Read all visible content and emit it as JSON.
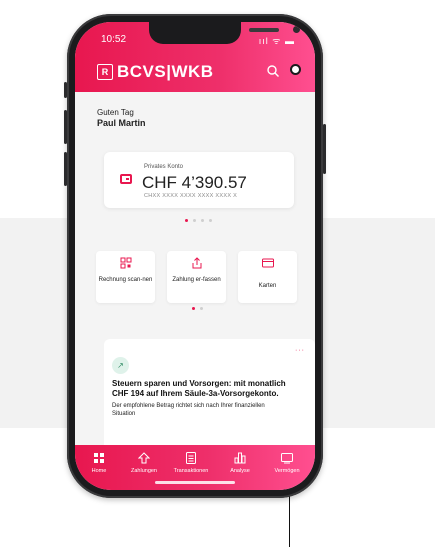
{
  "status_bar": {
    "time": "10:52",
    "indicators": "ııl ᯤ ▬"
  },
  "header": {
    "logo_mark": "R",
    "logo_text": "BCVS|WKB",
    "icons": [
      "search-icon",
      "account-icon"
    ]
  },
  "greeting": {
    "line1": "Guten Tag",
    "name": "Paul Martin"
  },
  "account": {
    "label": "Privates Konto",
    "balance": "CHF 4’390.57",
    "iban": "CHXX XXXX XXXX XXXX XXXX X",
    "carousel_dots": 4,
    "active_dot": 0
  },
  "quick_actions": [
    {
      "label": "Rechnung scan-nen",
      "icon": "qr-scan-icon"
    },
    {
      "label": "Zahlung er-fassen",
      "icon": "upload-icon"
    },
    {
      "label": "Karten",
      "icon": "card-icon"
    }
  ],
  "promo": {
    "icon": "growth-chart-icon",
    "more": "···",
    "title": "Steuern sparen und Vorsorgen: mit monatlich CHF 194 auf Ihrem Säule-3a-Vorsorgekonto.",
    "text": "Der empfohlene Betrag richtet sich nach Ihrer finanziellen Situation"
  },
  "tabbar": [
    {
      "label": "Home",
      "icon": "home-icon"
    },
    {
      "label": "Zahlungen",
      "icon": "payments-icon"
    },
    {
      "label": "Transaktionen",
      "icon": "transactions-icon"
    },
    {
      "label": "Analyse",
      "icon": "analysis-icon"
    },
    {
      "label": "Vermögen",
      "icon": "assets-icon"
    }
  ],
  "colors": {
    "accent": "#e8174f",
    "accent_light": "#ff4f90",
    "background": "#f4f4f4"
  }
}
